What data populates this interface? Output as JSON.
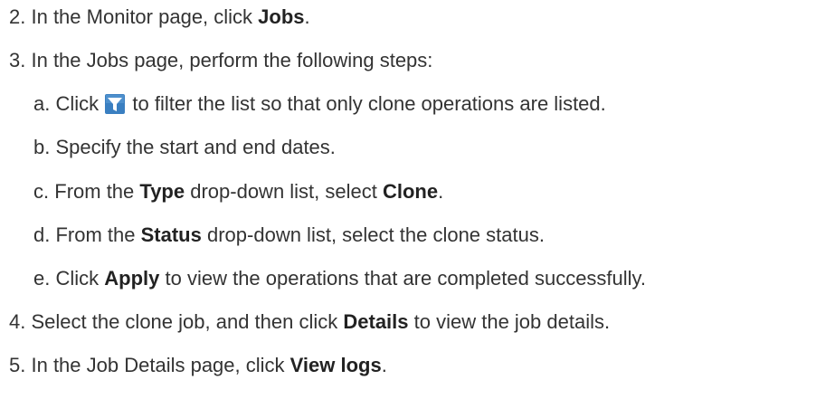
{
  "steps": [
    {
      "num": "2.",
      "parts": [
        "In the Monitor page, click ",
        "Jobs",
        "."
      ]
    },
    {
      "num": "3.",
      "parts": [
        "In the Jobs page, perform the following steps:"
      ]
    },
    {
      "num": "a.",
      "parts": [
        "Click ",
        " to filter the list so that only clone operations are listed."
      ],
      "icon": "filter-icon"
    },
    {
      "num": "b.",
      "parts": [
        "Specify the start and end dates."
      ]
    },
    {
      "num": "c.",
      "parts": [
        "From the ",
        "Type",
        " drop-down list, select ",
        "Clone",
        "."
      ]
    },
    {
      "num": "d.",
      "parts": [
        "From the ",
        "Status",
        " drop-down list, select the clone status."
      ]
    },
    {
      "num": "e.",
      "parts": [
        "Click ",
        "Apply",
        " to view the operations that are completed successfully."
      ]
    },
    {
      "num": "4.",
      "parts": [
        "Select the clone job, and then click ",
        "Details",
        " to view the job details."
      ]
    },
    {
      "num": "5.",
      "parts": [
        "In the Job Details page, click ",
        "View logs",
        "."
      ]
    }
  ],
  "colors": {
    "text": "#333333",
    "icon_bg": "#3a7fc1",
    "icon_mark": "#ffffff"
  }
}
